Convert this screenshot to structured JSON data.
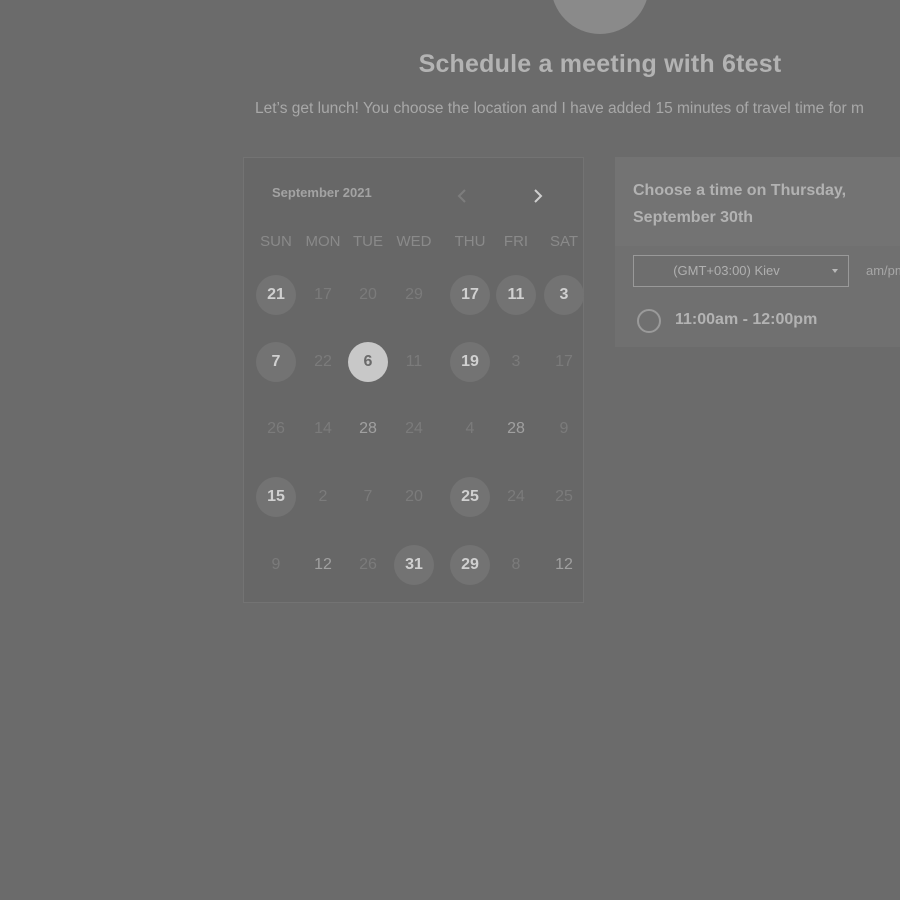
{
  "header": {
    "title": "Schedule a meeting with 6test",
    "description": "Let’s get lunch! You choose the location and I have added 15 minutes of travel time for m"
  },
  "calendar": {
    "month_label": "September 2021",
    "prev_icon": "chevron-left-icon",
    "next_icon": "chevron-right-icon",
    "weekdays": [
      "SUN",
      "MON",
      "TUE",
      "WED",
      "THU",
      "FRI",
      "SAT"
    ],
    "weeks": [
      [
        {
          "d": "21",
          "s": "available"
        },
        {
          "d": "17",
          "s": "disabled"
        },
        {
          "d": "20",
          "s": "disabled"
        },
        {
          "d": "29",
          "s": "disabled"
        },
        {
          "d": "17",
          "s": "available"
        },
        {
          "d": "11",
          "s": "available"
        },
        {
          "d": "3",
          "s": "available"
        }
      ],
      [
        {
          "d": "7",
          "s": "available"
        },
        {
          "d": "22",
          "s": "disabled"
        },
        {
          "d": "6",
          "s": "selected"
        },
        {
          "d": "11",
          "s": "disabled"
        },
        {
          "d": "19",
          "s": "available"
        },
        {
          "d": "3",
          "s": "disabled"
        },
        {
          "d": "17",
          "s": "disabled"
        }
      ],
      [
        {
          "d": "26",
          "s": "disabled"
        },
        {
          "d": "14",
          "s": "disabled"
        },
        {
          "d": "28",
          "s": "available-plain"
        },
        {
          "d": "24",
          "s": "disabled"
        },
        {
          "d": "4",
          "s": "disabled"
        },
        {
          "d": "28",
          "s": "available-plain"
        },
        {
          "d": "9",
          "s": "disabled"
        }
      ],
      [
        {
          "d": "15",
          "s": "available"
        },
        {
          "d": "2",
          "s": "disabled"
        },
        {
          "d": "7",
          "s": "disabled"
        },
        {
          "d": "20",
          "s": "disabled"
        },
        {
          "d": "25",
          "s": "available"
        },
        {
          "d": "24",
          "s": "disabled"
        },
        {
          "d": "25",
          "s": "disabled"
        }
      ],
      [
        {
          "d": "9",
          "s": "disabled"
        },
        {
          "d": "12",
          "s": "available-plain"
        },
        {
          "d": "26",
          "s": "disabled"
        },
        {
          "d": "31",
          "s": "available"
        },
        {
          "d": "29",
          "s": "available"
        },
        {
          "d": "8",
          "s": "disabled"
        },
        {
          "d": "12",
          "s": "available-plain"
        }
      ]
    ]
  },
  "times": {
    "heading": "Choose a time on Thursday, September 30th",
    "timezone": "(GMT+03:00) Kiev",
    "timezone_icon": "caret-down-icon",
    "format_toggle": "am/pm",
    "slots": [
      "11:00am - 12:00pm"
    ]
  },
  "colors": {
    "background": "#6b6b6b",
    "available_circle": "#737373",
    "selected_circle": "#c8c8c8"
  }
}
